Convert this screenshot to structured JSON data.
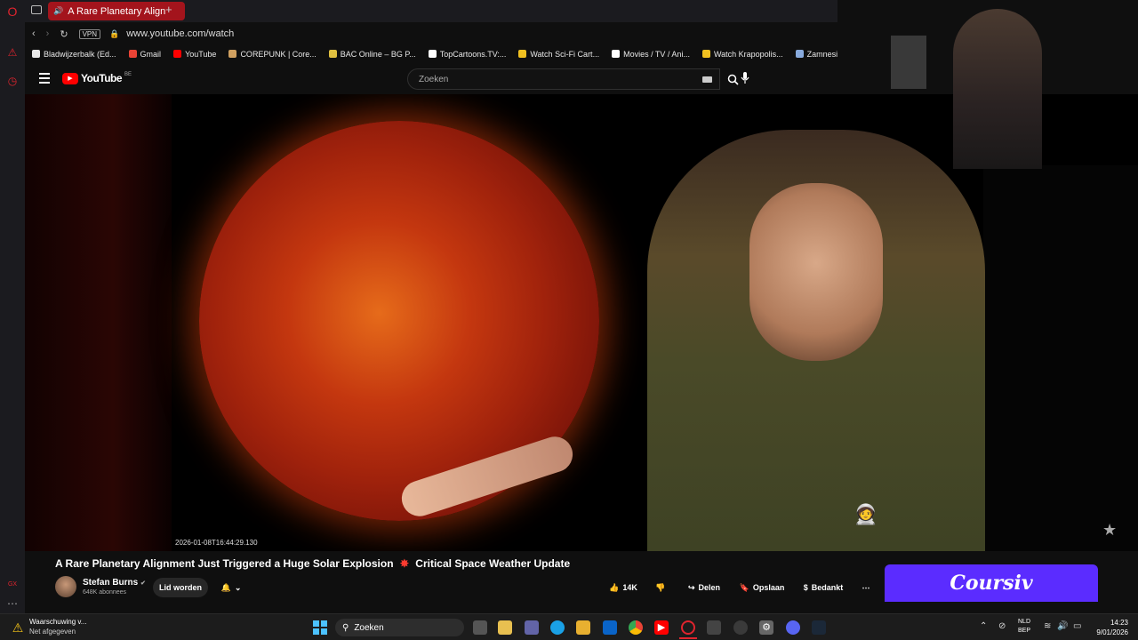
{
  "browser": {
    "tab_title": "A Rare Planetary Align",
    "vpn_label": "VPN",
    "url": "www.youtube.com/watch",
    "bookmarks": [
      {
        "label": "Bladwijzerbalk (Ed...",
        "color": "#e8e8e8"
      },
      {
        "label": "Gmail",
        "color": "#ea4335"
      },
      {
        "label": "YouTube",
        "color": "#ff0000"
      },
      {
        "label": "COREPUNK | Core...",
        "color": "#d0a060"
      },
      {
        "label": "BAC Online – BG P...",
        "color": "#e0c040"
      },
      {
        "label": "TopCartoons.TV:...",
        "color": "#ffffff"
      },
      {
        "label": "Watch Sci-Fi Cart...",
        "color": "#f0c020"
      },
      {
        "label": "Movies / TV / Ani...",
        "color": "#ffffff"
      },
      {
        "label": "Watch Krapopolis...",
        "color": "#f0c020"
      },
      {
        "label": "Zamnesia | Het Be",
        "color": "#8ad"
      }
    ]
  },
  "youtube": {
    "logo_text": "YouTube",
    "logo_region": "BE",
    "search_placeholder": "Zoeken",
    "video_timestamp": "2026-01-08T16:44:29.130",
    "video_title": "A Rare Planetary Alignment Just Triggered a Huge Solar Explosion",
    "video_title_suffix": "Critical Space Weather Update",
    "channel_name": "Stefan Burns",
    "subscribers": "648K abonnees",
    "join_label": "Lid worden",
    "likes": "14K",
    "share_label": "Delen",
    "save_label": "Opslaan",
    "thanks_label": "Bedankt",
    "ad_brand": "Coursiv"
  },
  "taskbar": {
    "warning_title": "Waarschuwing v...",
    "warning_subtitle": "Net afgegeven",
    "search_label": "Zoeken",
    "lang_top": "NLD",
    "lang_bottom": "BEP",
    "time": "14:23",
    "date": "9/01/2026"
  },
  "colors": {
    "accent_red": "#ff0000",
    "opera_red": "#e0242e",
    "ad_purple": "#5b2cff"
  }
}
